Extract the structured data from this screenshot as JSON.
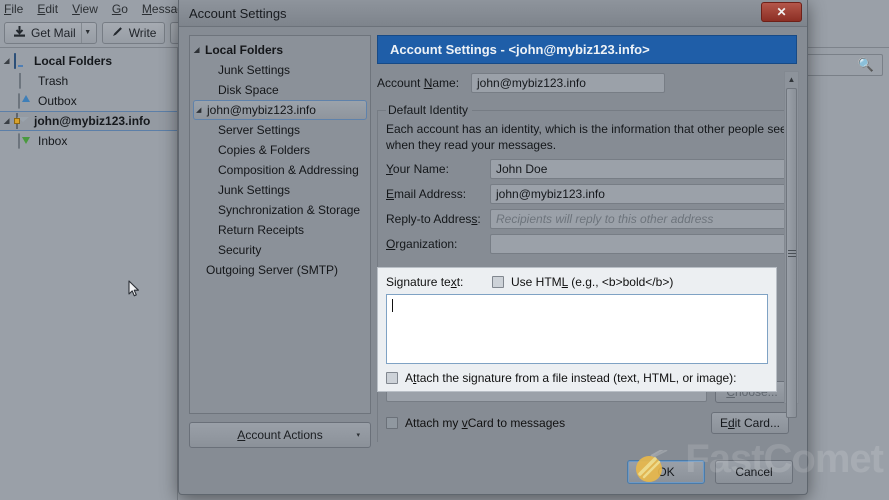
{
  "background_window": {
    "menubar": [
      {
        "label": "File",
        "accel": "F"
      },
      {
        "label": "Edit",
        "accel": "E"
      },
      {
        "label": "View",
        "accel": "V"
      },
      {
        "label": "Go",
        "accel": "G"
      },
      {
        "label": "Message",
        "accel": "M"
      }
    ],
    "toolbar": {
      "get_mail": "Get Mail",
      "write": "Write"
    },
    "search_placeholder": "",
    "folders": [
      {
        "label": "Local Folders",
        "icon": "monitor-icon",
        "level": 0,
        "selected": false,
        "twisty": "◢"
      },
      {
        "label": "Trash",
        "icon": "trash-icon",
        "level": 1,
        "selected": false,
        "twisty": ""
      },
      {
        "label": "Outbox",
        "icon": "outbox-icon",
        "level": 1,
        "selected": false,
        "twisty": ""
      },
      {
        "label": "john@mybiz123.info",
        "icon": "account-envelope-icon",
        "level": 0,
        "selected": true,
        "twisty": "◢"
      },
      {
        "label": "Inbox",
        "icon": "inbox-icon",
        "level": 1,
        "selected": false,
        "twisty": ""
      }
    ]
  },
  "dialog": {
    "title": "Account Settings",
    "close_label": "✕",
    "tree": [
      {
        "label": "Local Folders",
        "bold": true,
        "indent": 0,
        "twisty": "◢",
        "selected": false
      },
      {
        "label": "Junk Settings",
        "bold": false,
        "indent": 2,
        "twisty": "",
        "selected": false
      },
      {
        "label": "Disk Space",
        "bold": false,
        "indent": 2,
        "twisty": "",
        "selected": false
      },
      {
        "label": "john@mybiz123.info",
        "bold": false,
        "indent": 0,
        "twisty": "◢",
        "selected": true
      },
      {
        "label": "Server Settings",
        "bold": false,
        "indent": 2,
        "twisty": "",
        "selected": false
      },
      {
        "label": "Copies & Folders",
        "bold": false,
        "indent": 2,
        "twisty": "",
        "selected": false
      },
      {
        "label": "Composition & Addressing",
        "bold": false,
        "indent": 2,
        "twisty": "",
        "selected": false
      },
      {
        "label": "Junk Settings",
        "bold": false,
        "indent": 2,
        "twisty": "",
        "selected": false
      },
      {
        "label": "Synchronization & Storage",
        "bold": false,
        "indent": 2,
        "twisty": "",
        "selected": false
      },
      {
        "label": "Return Receipts",
        "bold": false,
        "indent": 2,
        "twisty": "",
        "selected": false
      },
      {
        "label": "Security",
        "bold": false,
        "indent": 2,
        "twisty": "",
        "selected": false
      },
      {
        "label": "Outgoing Server (SMTP)",
        "bold": false,
        "indent": 1,
        "twisty": "",
        "selected": false
      }
    ],
    "account_actions_label": "Account Actions",
    "account_actions_accel": "A",
    "account_actions_caret": "▾",
    "panel": {
      "header": "Account Settings - <john@mybiz123.info>",
      "account_name_label_pre": "Account ",
      "account_name_label_accel": "N",
      "account_name_label_post": "ame:",
      "account_name_value": "john@mybiz123.info",
      "group_legend": "Default Identity",
      "group_description": "Each account has an identity, which is the information that other people see when they read your messages.",
      "fields": [
        {
          "label_pre": "",
          "accel": "Y",
          "label_post": "our Name:",
          "value": "John Doe",
          "placeholder": false
        },
        {
          "label_pre": "",
          "accel": "E",
          "label_post": "mail Address:",
          "value": "john@mybiz123.info",
          "placeholder": false
        },
        {
          "label_pre": "Reply-to Addres",
          "accel": "s",
          "label_post": ":",
          "value": "Recipients will reply to this other address",
          "placeholder": true
        },
        {
          "label_pre": "",
          "accel": "O",
          "label_post": "rganization:",
          "value": "",
          "placeholder": false
        }
      ],
      "signature": {
        "label_pre": "Signature te",
        "label_accel": "x",
        "label_post": "t:",
        "use_html_pre": "Use HTM",
        "use_html_accel": "L",
        "use_html_post": " (e.g., <b>bold</b>)",
        "use_html_checked": false,
        "textarea_value": "",
        "attach_file_pre": "A",
        "attach_file_accel": "t",
        "attach_file_post": "tach the signature from a file instead (text, HTML, or image):",
        "attach_file_checked": false
      },
      "file_path_value": "",
      "choose_button_pre": "",
      "choose_button_accel": "C",
      "choose_button_post": "hoose...",
      "vcard_pre": "Attach my ",
      "vcard_accel": "v",
      "vcard_post": "Card to messages",
      "vcard_checked": false,
      "edit_card_pre": "E",
      "edit_card_accel": "d",
      "edit_card_post": "it Card..."
    },
    "buttons": {
      "ok": "OK",
      "cancel": "Cancel"
    },
    "scrollbar": {
      "up": "▲",
      "down": "▼"
    }
  },
  "watermark": "FastComet",
  "colors": {
    "panel_header_blue": "#1f5ea8",
    "close_red": "#8c2f24",
    "dialog_bg": "#868c94",
    "window_bg": "#9aa0a8",
    "signature_overlay": "#eceff2",
    "cursor_highlight": "#e8b84b"
  }
}
